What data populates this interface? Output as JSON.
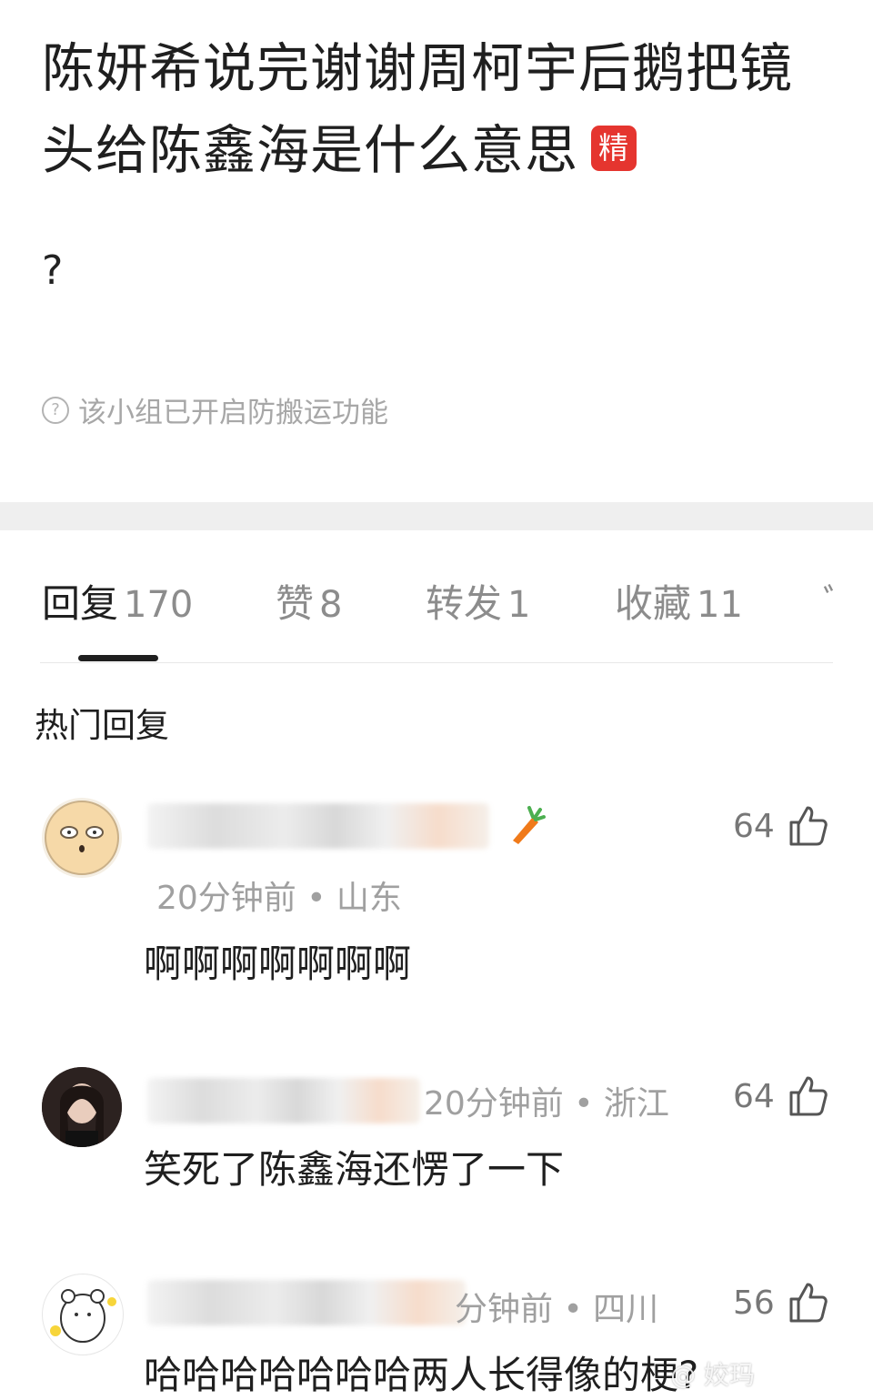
{
  "post": {
    "title": "陈妍希说完谢谢周柯宇后鹅把镜头给陈鑫海是什么意思",
    "badge": "精",
    "body": "?",
    "notice": "该小组已开启防搬运功能"
  },
  "tabs": [
    {
      "label": "回复",
      "count": "170",
      "active": true
    },
    {
      "label": "赞",
      "count": "8"
    },
    {
      "label": "转发",
      "count": "1"
    },
    {
      "label": "收藏",
      "count": "11"
    },
    {
      "label": "ﾞ",
      "count": ""
    }
  ],
  "section_title": "热门回复",
  "comments": [
    {
      "time_location": "20分钟前 • 山东",
      "content": "啊啊啊啊啊啊啊",
      "likes": "64",
      "avatar": "cartoon-face-avatar",
      "badge_icon": "carrot-icon"
    },
    {
      "time_location": "20分钟前 • 浙江",
      "content": "笑死了陈鑫海还愣了一下",
      "likes": "64",
      "avatar": "photo-avatar"
    },
    {
      "time_location": "分钟前 • 四川",
      "content": "哈哈哈哈哈哈哈两人长得像的梗?",
      "likes": "56",
      "avatar": "cartoon-bear-avatar"
    }
  ],
  "watermark": "@ 姣玛",
  "colors": {
    "badge_red": "#e5352f",
    "text_dark": "#1f1f1f",
    "text_gray": "#a0a0a0"
  }
}
